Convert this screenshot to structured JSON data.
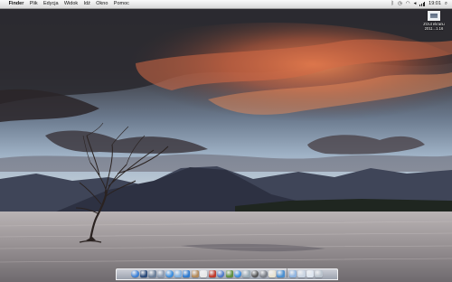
{
  "menubar": {
    "apple_symbol": "",
    "items": [
      "Finder",
      "Plik",
      "Edycja",
      "Widok",
      "Idź",
      "Okno",
      "Pomoc"
    ],
    "clock": "19:01",
    "status_icons": [
      "bluetooth-icon",
      "time-machine-icon",
      "wifi-icon",
      "volume-icon",
      "battery-icon",
      "spotlight-icon"
    ]
  },
  "desktop_icon": {
    "label_line1": "Zrzut ekranu",
    "label_line2": "2011...1.16"
  },
  "dock": {
    "apps": [
      {
        "name": "finder-icon",
        "color": "#3b7fd6"
      },
      {
        "name": "dashboard-icon",
        "color": "#2a4a7a"
      },
      {
        "name": "mission-control-icon",
        "color": "#6b7f99"
      },
      {
        "name": "launchpad-icon",
        "color": "#8a9ab0"
      },
      {
        "name": "safari-icon",
        "color": "#3a8ee0"
      },
      {
        "name": "mail-icon",
        "color": "#7fb0e0"
      },
      {
        "name": "ichat-icon",
        "color": "#2e7bd0"
      },
      {
        "name": "address-book-icon",
        "color": "#b38a5a"
      },
      {
        "name": "calendar-icon",
        "color": "#e8e8e8"
      },
      {
        "name": "photo-booth-icon",
        "color": "#c0392b"
      },
      {
        "name": "itunes-icon",
        "color": "#4a78c8"
      },
      {
        "name": "iphoto-icon",
        "color": "#5f8f3f"
      },
      {
        "name": "app-store-icon",
        "color": "#3d8fe0"
      },
      {
        "name": "preview-icon",
        "color": "#9aaab5"
      },
      {
        "name": "facetime-icon",
        "color": "#555555"
      },
      {
        "name": "system-preferences-icon",
        "color": "#7a7f87"
      },
      {
        "name": "textedit-icon",
        "color": "#e7e2d0"
      },
      {
        "name": "app-icon",
        "color": "#4a8fd0"
      }
    ],
    "docs": [
      {
        "name": "applications-stack-icon",
        "color": "#8fb4e0"
      },
      {
        "name": "documents-stack-icon",
        "color": "#c9d4e2"
      },
      {
        "name": "downloads-stack-icon",
        "color": "#dde5ef"
      },
      {
        "name": "trash-icon",
        "color": "#b9c2cc"
      }
    ]
  }
}
